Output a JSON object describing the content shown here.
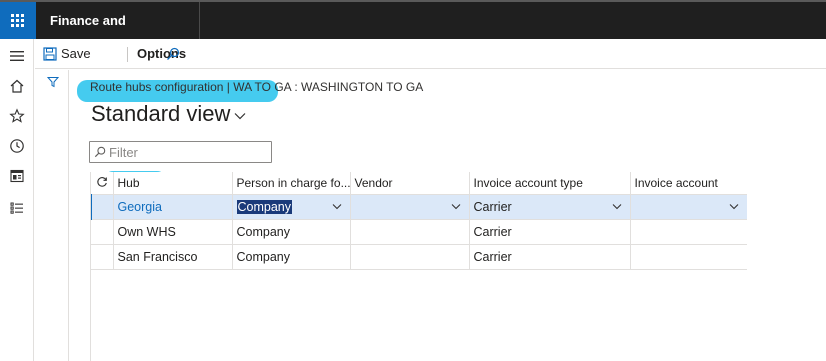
{
  "app": {
    "title": "Finance and Operations"
  },
  "nav_icons": [
    "menu-icon",
    "home-icon",
    "star-icon",
    "clock-icon",
    "workspace-icon",
    "list-icon"
  ],
  "toolbar": {
    "save_label": "Save",
    "options_label": "Options"
  },
  "breadcrumb": {
    "text": "Route hubs configuration  |  WA TO GA : WASHINGTON TO GA"
  },
  "page": {
    "title": "Standard view"
  },
  "filter": {
    "placeholder": "Filter"
  },
  "grid": {
    "columns": [
      "Hub",
      "Person in charge fo...",
      "Vendor",
      "Invoice account type",
      "Invoice account"
    ],
    "rows": [
      {
        "hub": "Georgia",
        "person": "Company",
        "vendor": "",
        "invoice_type": "Carrier",
        "invoice_account": ""
      },
      {
        "hub": "Own WHS",
        "person": "Company",
        "vendor": "",
        "invoice_type": "Carrier",
        "invoice_account": ""
      },
      {
        "hub": "San Francisco",
        "person": "Company",
        "vendor": "",
        "invoice_type": "Carrier",
        "invoice_account": ""
      }
    ]
  },
  "colors": {
    "accent": "#0f6cbd",
    "highlight": "#3bc8ee",
    "topbar": "#1f1f1f",
    "selected_row": "#dbe8f8"
  }
}
